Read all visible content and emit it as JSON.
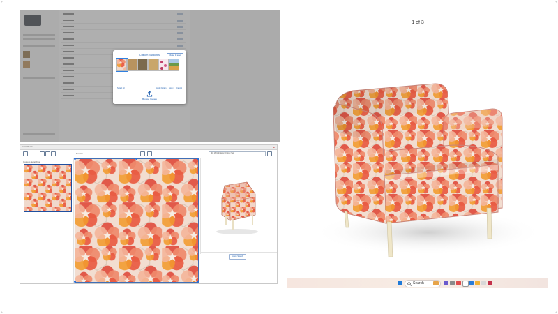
{
  "swatch_dialog": {
    "title": "Custom Swatches",
    "close_label": "Close & save",
    "left_link": "Select all",
    "mid_links": [
      "Apply button",
      "Apply",
      "Cancel"
    ],
    "browse_label": "Browse Images"
  },
  "editor": {
    "window_label": "SwatchStudio",
    "toolbar_label": "Swatch",
    "panel_label": "Custom Swatches",
    "preview_title": "Mill 16 Upholstery Fabric Set",
    "apply_label": "Apply Swatch"
  },
  "pdf_viewer": {
    "page_indicator": "1 of 3"
  },
  "taskbar": {
    "search_label": "Search"
  },
  "colors": {
    "accent": "#1f5fb0",
    "fabric_base": "#f2ddd0",
    "petal_red": "#e04e3f",
    "petal_coral": "#ef8a6c",
    "petal_orange": "#f29a2e",
    "wood_legs": "#efe6c8"
  }
}
